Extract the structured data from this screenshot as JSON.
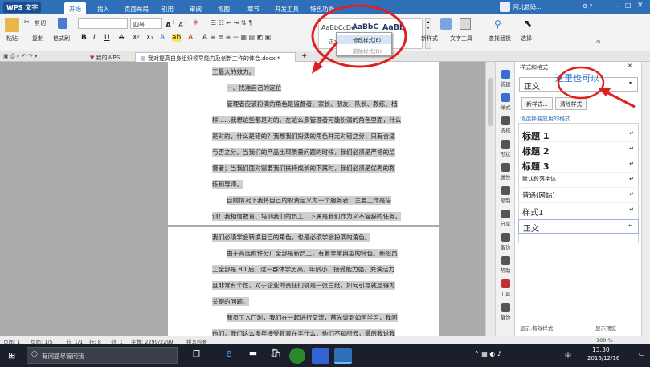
{
  "app": {
    "logo": "WPS 文字",
    "menu": [
      "开始",
      "插入",
      "页面布局",
      "引用",
      "审阅",
      "视图",
      "章节",
      "开发工具",
      "特色功能"
    ]
  },
  "titlebar": {
    "user": "阿北数码..."
  },
  "ribbon": {
    "paste": "粘贴",
    "cut": "剪切",
    "copy": "复制",
    "format_painter": "格式刷",
    "font_name": "",
    "font_size": "四号",
    "style_preview": [
      "AaBbCcDd",
      "AaBbC",
      "AaBb"
    ],
    "style_labels": [
      "正文",
      "标题 1",
      "标题 2"
    ],
    "context_menu": [
      "修改样式(E)",
      "删除样式(D)"
    ],
    "new_style": "新样式",
    "text_tools": "文字工具",
    "find_replace": "查找替换",
    "select": "选择"
  },
  "tabs": {
    "my_wps": "我的WPS",
    "doc": "我对提高自身组织领导能力及创新工作的体会.docx *",
    "add": "+"
  },
  "document": {
    "page1_lines": [
      "工最大的效力。",
      "一、找准自己的定位",
      "管理者应该扮演的角色是监督者、家长、朋友、队长、教练、楷",
      "样……我想这些都是对的。在这么多管理者可能扮演的角色里面，什么",
      "是对的，什么是错的？我想我们扮演的角色并无对错之分，只有合适",
      "与否之分。当我们的产品出现质量问题的时候，我们必须是严格的监",
      "督者；当我们面对需要我们扶持成长的下属时，我们必须是优秀的教",
      "练和导师。",
      "目前情况下我将自己的职责定义为一个服务者，主要工作是培",
      "训！我相信教育、培训我们的员工，下属是我们作为义不容辞的任务。"
    ],
    "page2_lines": [
      "我们必须学会转换自己的角色，也是必须学会扮演的角色。",
      "由于高压附件分厂全部是新员工，有着非常典型的特色。新招员",
      "工全部是 80 后，这一群体学历高，年龄小，接受能力强，充满活力",
      "且非常有个性，对于企业的责任们就是一张白纸，如何引导就显得为",
      "关键的问题。",
      "新员工入厂时，我们在一起进行交流，首先谈到如何学习，我问",
      "他们，我们这么多年接受教育在学什么，他们不知所云，最后我说我"
    ]
  },
  "sidebar": [
    "新建",
    "样式",
    "选择",
    "形状",
    "属性",
    "限制",
    "分享",
    "备份",
    "帮助",
    "工具",
    "备份"
  ],
  "panel": {
    "header": "样式和格式",
    "annotation": "这里也可以",
    "current_style": "正文",
    "new_button": "新样式...",
    "clear_button": "清除样式",
    "section_label": "请选择要应用的格式",
    "styles": [
      "标题 1",
      "标题 2",
      "标题 3",
      "默认段落字体",
      "普通(网站)",
      "样式1",
      "正文"
    ],
    "footer_left": "显示:有效样式",
    "footer_right": "显示预览"
  },
  "status": {
    "page": "页面: 1",
    "pages": "页面: 1/5",
    "section": "节: 1/1",
    "row": "行: 8",
    "col": "列: 1",
    "words": "字数: 2299/2299",
    "spell": "拼写检查",
    "zoom": "100 %"
  },
  "taskbar": {
    "search": "有问题尽管问我",
    "time": "13:30",
    "date": "2016/12/16",
    "ime": "中"
  },
  "colors": {
    "title_blue": "#2f6fb7",
    "highlight": "#cfcfcf",
    "annotation_red": "#e02020"
  }
}
